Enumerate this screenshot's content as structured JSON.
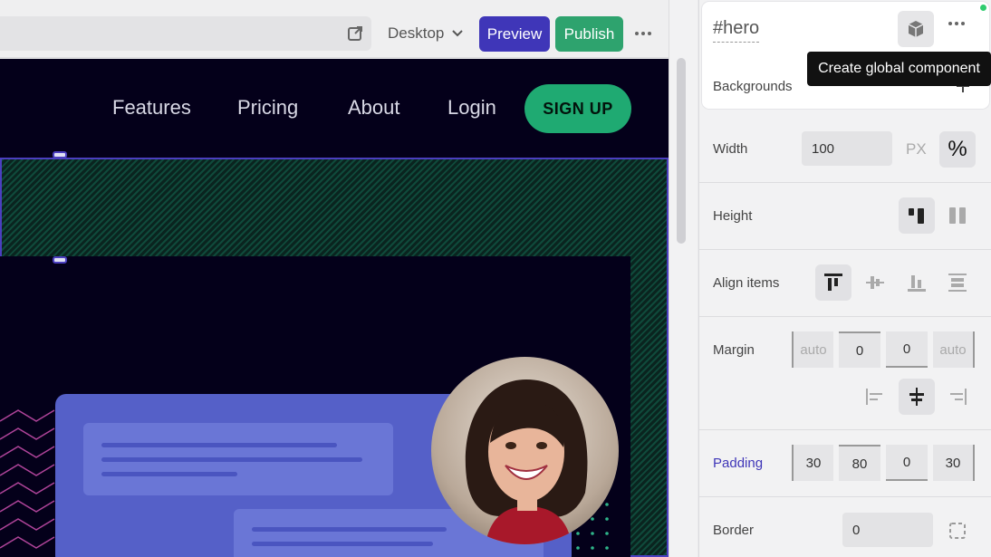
{
  "toolbar": {
    "device": "Desktop",
    "preview_label": "Preview",
    "publish_label": "Publish"
  },
  "canvas": {
    "nav_links": [
      "Features",
      "Pricing",
      "About",
      "Login"
    ],
    "signup_label": "SIGN UP"
  },
  "panel": {
    "element_hash": "#",
    "element_name": "hero",
    "tooltip": "Create global component",
    "backgrounds_label": "Backgrounds",
    "width": {
      "label": "Width",
      "value": "100",
      "unit_px": "PX",
      "unit_pct": "%"
    },
    "height_label": "Height",
    "align_label": "Align items",
    "margin": {
      "label": "Margin",
      "values": [
        "auto",
        "0",
        "0",
        "auto"
      ]
    },
    "padding": {
      "label": "Padding",
      "values": [
        "30",
        "80",
        "0",
        "30"
      ]
    },
    "border": {
      "label": "Border",
      "value": "0"
    }
  },
  "colors": {
    "preview": "#3f36b8",
    "publish": "#2ea36e",
    "signup": "#1faa72",
    "padding_label": "#3f36b8",
    "canvas_bg": "#04001a"
  },
  "icons": [
    "external-link-icon",
    "chevron-down-icon",
    "more-icon",
    "cube-icon",
    "plus-icon",
    "percent-icon",
    "height-fixed-icon",
    "height-auto-icon",
    "align-top-icon",
    "align-center-icon",
    "align-bottom-icon",
    "align-stretch-icon",
    "align-left-icon",
    "align-center-h-icon",
    "align-right-icon",
    "border-icon"
  ]
}
